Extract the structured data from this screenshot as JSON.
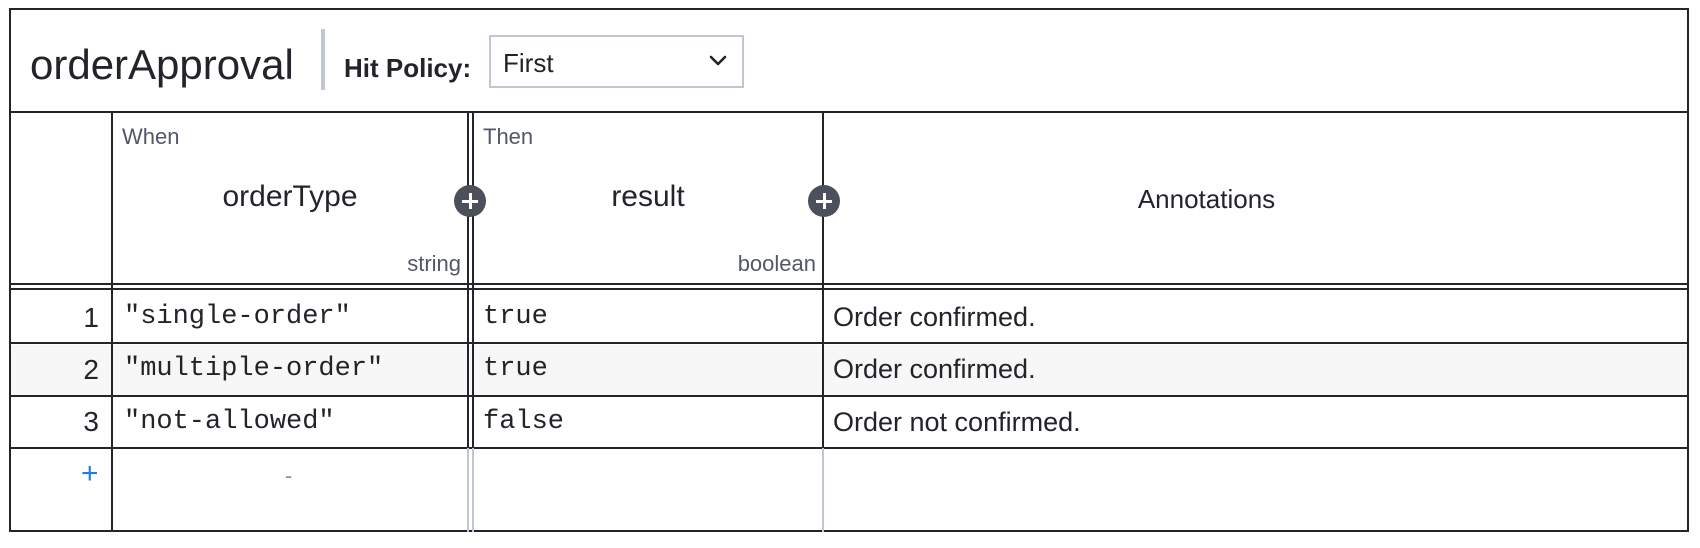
{
  "decision": {
    "name": "orderApproval"
  },
  "hit_policy": {
    "label": "Hit Policy:",
    "value": "First",
    "chevron_icon": "chevron-down-icon"
  },
  "columns": {
    "input": {
      "clause": "When",
      "label": "orderType",
      "type": "string"
    },
    "output": {
      "clause": "Then",
      "label": "result",
      "type": "boolean"
    },
    "annotations": {
      "label": "Annotations"
    }
  },
  "rows": [
    {
      "index": "1",
      "input": "\"single-order\"",
      "output": "true",
      "annotation": "Order confirmed."
    },
    {
      "index": "2",
      "input": "\"multiple-order\"",
      "output": "true",
      "annotation": "Order confirmed."
    },
    {
      "index": "3",
      "input": "\"not-allowed\"",
      "output": "false",
      "annotation": "Order not confirmed."
    }
  ],
  "add_row": {
    "symbol": "+",
    "placeholder": "-"
  },
  "icons": {
    "add_input": "plus-circle-icon",
    "add_output": "plus-circle-icon"
  },
  "colors": {
    "border": "#22242a",
    "muted": "#52586a",
    "accent": "#1f7ee0",
    "stripe": "#f7f7f8",
    "add_button": "#4d4f5a"
  }
}
